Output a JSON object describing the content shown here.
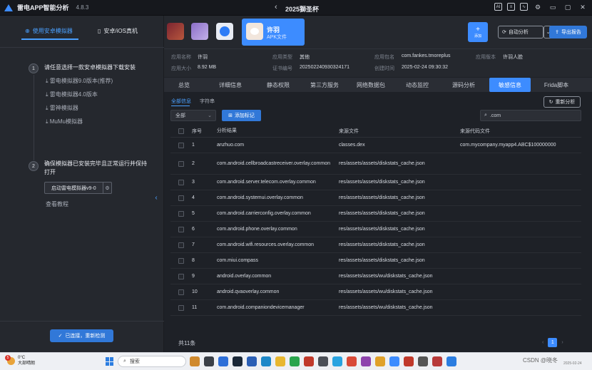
{
  "titlebar": {
    "app_title": "雷电APP智能分析",
    "version": "4.8.3",
    "center_title": "2025獅圣杯"
  },
  "left": {
    "tab_android": "使用安卓模拟器",
    "tab_ios": "安卓/iOS真机",
    "step1": {
      "num": "1",
      "title": "请任意选择一款安卓模拟器下载安装",
      "links": [
        "雷电模拟器9.0版本(推荐)",
        "雷电模拟器4.0版本",
        "雷神模拟器",
        "MuMu模拟器"
      ]
    },
    "step2": {
      "num": "2",
      "title": "确保模拟器已安装完毕且正常运行并保持打开"
    },
    "launch_label": "启动雷电模拟器v9-0",
    "tutorial": "查看教程",
    "connect_label": "已连接，重新检测"
  },
  "topstrip": {
    "app_name": "许羽",
    "app_sub": "APK文件",
    "add_label": "添加",
    "auto_label": "自动分析",
    "export_label": "导出报告"
  },
  "info": {
    "row1": [
      {
        "k": "应用名称",
        "v": "许羽"
      },
      {
        "k": "应用类型",
        "v": "其他"
      },
      {
        "k": "应用包名",
        "v": "com.fankes.tmoreplus"
      },
      {
        "k": "应用版本",
        "v": "许羽人脸"
      }
    ],
    "row2": [
      {
        "k": "应用大小",
        "v": "8.92 MB"
      },
      {
        "k": "证书编号",
        "v": "202502240930324171"
      },
      {
        "k": "创建时间",
        "v": "2025-02-24 09:30:32"
      }
    ]
  },
  "tabs": [
    "总览",
    "详细信息",
    "静态权限",
    "第三方服务",
    "网络数据包",
    "动态监控",
    "源码分析",
    "敏感信息",
    "Frida脚本"
  ],
  "content": {
    "subtab_all": "全部信息",
    "subtab_str": "字符串",
    "rescan": "重新分析",
    "filter": "全部",
    "addmark": "添加标记",
    "search_value": ".com",
    "headers": {
      "idx": "序号",
      "result": "分析结果",
      "source": "来源文件",
      "code": "来源代码文件"
    },
    "rows": [
      {
        "idx": "1",
        "result": "anzhuo.com",
        "source": "classes.dex",
        "code": "com.mycompany.myapp4.ABC$100000000"
      },
      {
        "idx": "2",
        "result": "com.android.cellbroadcastreceiver.overlay.common",
        "source": "res/assets/assets/diskstats_cache.json",
        "code": ""
      },
      {
        "idx": "3",
        "result": "com.android.server.telecom.overlay.common",
        "source": "res/assets/assets/diskstats_cache.json",
        "code": ""
      },
      {
        "idx": "4",
        "result": "com.android.systemui.overlay.common",
        "source": "res/assets/assets/diskstats_cache.json",
        "code": ""
      },
      {
        "idx": "5",
        "result": "com.android.carrierconfig.overlay.common",
        "source": "res/assets/assets/diskstats_cache.json",
        "code": ""
      },
      {
        "idx": "6",
        "result": "com.android.phone.overlay.common",
        "source": "res/assets/assets/diskstats_cache.json",
        "code": ""
      },
      {
        "idx": "7",
        "result": "com.android.wifi.resources.overlay.common",
        "source": "res/assets/assets/diskstats_cache.json",
        "code": ""
      },
      {
        "idx": "8",
        "result": "com.miui.compass",
        "source": "res/assets/assets/diskstats_cache.json",
        "code": ""
      },
      {
        "idx": "9",
        "result": "android.overlay.common",
        "source": "res/assets/assets/wu/diskstats_cache.json",
        "code": ""
      },
      {
        "idx": "10",
        "result": "android.qvaoverlay.common",
        "source": "res/assets/assets/wu/diskstats_cache.json",
        "code": ""
      },
      {
        "idx": "11",
        "result": "com.android.companiondevicemanager",
        "source": "res/assets/assets/wu/diskstats_cache.json",
        "code": ""
      }
    ],
    "total": "共11条",
    "page": "1"
  },
  "taskbar": {
    "temp": "0°C",
    "weather": "大部晴朗",
    "badge": "5",
    "search": "搜索",
    "tray": "CSDN @晓冬",
    "date": "2025-02-24"
  },
  "colors": {
    "accent": "#3d8cff",
    "bg": "#1e2127",
    "panel": "#25282e"
  }
}
